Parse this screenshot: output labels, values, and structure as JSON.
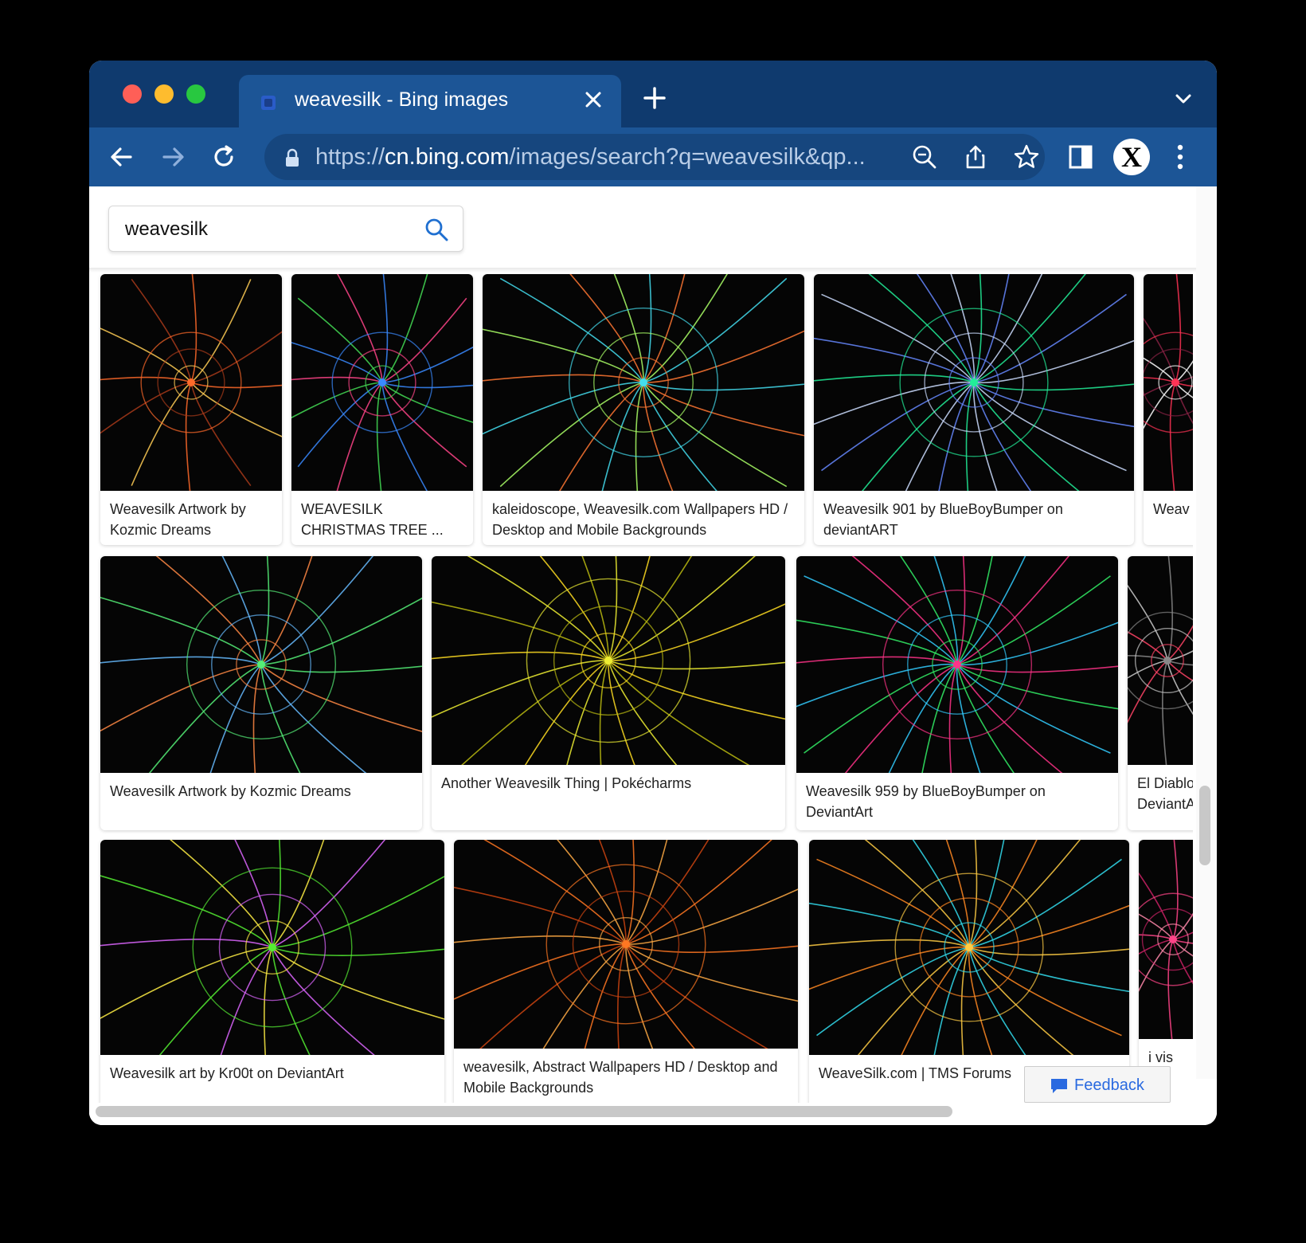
{
  "browser": {
    "tab_title": "weavesilk - Bing images",
    "url_scheme": "https://",
    "url_host": "cn.bing.com",
    "url_path": "/images/search?q=weavesilk&qp...",
    "profile_initial": "X"
  },
  "search": {
    "query": "weavesilk"
  },
  "results": [
    {
      "caption": "Weavesilk Artwork by Kozmic Dreams",
      "palette": [
        "#ff6a2a",
        "#ffcc55",
        "#a83a1a"
      ]
    },
    {
      "caption": "WEAVESILK CHRISTMAS TREE ...",
      "palette": [
        "#3a8aff",
        "#44dd55",
        "#ff4488"
      ]
    },
    {
      "caption": "kaleidoscope, Weavesilk.com Wallpapers HD / Desktop and Mobile Backgrounds",
      "palette": [
        "#44ddee",
        "#ff7733",
        "#aaff66"
      ]
    },
    {
      "caption": "Weavesilk 901 by BlueBoyBumper on deviantART",
      "palette": [
        "#22ee99",
        "#6688ff",
        "#ccddff"
      ]
    },
    {
      "caption": "Weav",
      "palette": [
        "#ff3355",
        "#ffffff",
        "#882244"
      ]
    },
    {
      "caption": "Weavesilk Artwork by Kozmic Dreams",
      "palette": [
        "#55ee77",
        "#ff8844",
        "#66bbff"
      ]
    },
    {
      "caption": "Another Weavesilk Thing | Pokécharms",
      "palette": [
        "#eeee33",
        "#ffdd22",
        "#bbbb11"
      ]
    },
    {
      "caption": "Weavesilk 959 by BlueBoyBumper on DeviantArt",
      "palette": [
        "#ff3388",
        "#33ee66",
        "#33ccff"
      ]
    },
    {
      "caption": "El Diablo DeviantA",
      "palette": [
        "#888888",
        "#ff4466",
        "#cccccc"
      ]
    },
    {
      "caption": "Weavesilk art by Kr00t on DeviantArt",
      "palette": [
        "#55ee33",
        "#ffee44",
        "#dd66ff"
      ]
    },
    {
      "caption": "weavesilk, Abstract Wallpapers HD / Desktop and Mobile Backgrounds",
      "palette": [
        "#ff7722",
        "#ffaa44",
        "#cc4411"
      ]
    },
    {
      "caption": "WeaveSilk.com | TMS Forums",
      "palette": [
        "#ffcc44",
        "#33ddee",
        "#ff8822"
      ]
    },
    {
      "caption": "i vis",
      "palette": [
        "#ff4488",
        "#ff88aa",
        "#cc2266"
      ]
    }
  ],
  "feedback_label": "Feedback"
}
